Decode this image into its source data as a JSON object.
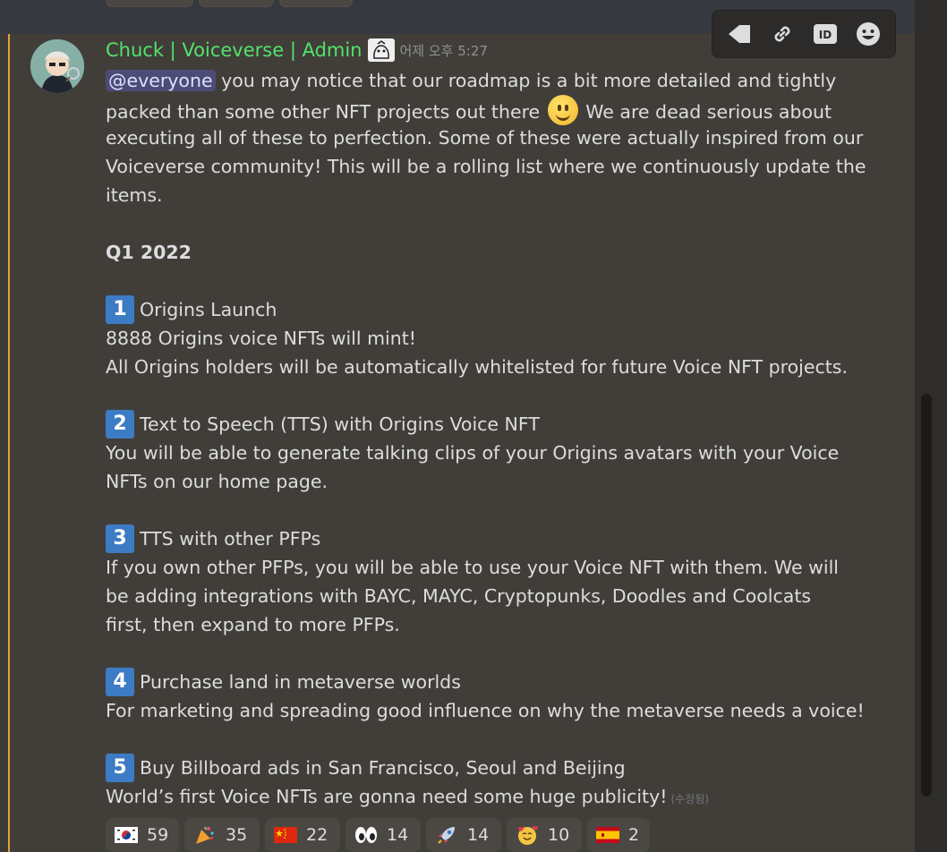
{
  "message": {
    "username": "Chuck | Voiceverse | Admin",
    "timestamp": "어제 오후 5:27",
    "mention": "@everyone",
    "intro_line1_rest": " you may notice that our roadmap is a bit more detailed and tightly",
    "intro_line2_a": "packed than some other NFT projects out there ",
    "intro_line2_b": " We are dead serious about",
    "intro_line3": "executing all of these to perfection. Some of these were actually inspired from our",
    "intro_line4": "Voiceverse community! This will be a rolling list where we continuously update the",
    "intro_line5": "items.",
    "section_title": "Q1 2022",
    "items": [
      {
        "number": "1",
        "title": "Origins Launch",
        "lines": [
          "8888 Origins voice NFTs will mint!",
          "All Origins holders will be automatically whitelisted for future Voice NFT projects."
        ]
      },
      {
        "number": "2",
        "title": "Text to Speech (TTS) with Origins Voice NFT",
        "lines": [
          "You will be able to generate talking clips of your Origins avatars with your Voice",
          "NFTs on our home page."
        ]
      },
      {
        "number": "3",
        "title": "TTS with other PFPs",
        "lines": [
          "If you own other PFPs, you will be able to use your Voice NFT with them. We will",
          "be adding integrations with BAYC, MAYC, Cryptopunks, Doodles and Coolcats",
          "first, then expand to more PFPs."
        ]
      },
      {
        "number": "4",
        "title": "Purchase land in metaverse worlds",
        "lines": [
          "For marketing and spreading good influence on why the metaverse needs a voice!"
        ]
      },
      {
        "number": "5",
        "title": "Buy Billboard ads in San Francisco, Seoul and Beijing",
        "lines": [
          "World’s first Voice NFTs are gonna need some huge publicity!"
        ]
      }
    ],
    "edited_label": "(수정됨)"
  },
  "reactions": [
    {
      "icon": "korea-flag-icon",
      "count": "59"
    },
    {
      "icon": "party-popper-icon",
      "count": "35"
    },
    {
      "icon": "china-flag-icon",
      "count": "22"
    },
    {
      "icon": "eyes-icon",
      "count": "14"
    },
    {
      "icon": "rocket-icon",
      "count": "14"
    },
    {
      "icon": "smiling-hearts-icon",
      "count": "10"
    },
    {
      "icon": "spain-flag-icon",
      "count": "2"
    }
  ],
  "toolbar": [
    "reply-icon",
    "link-icon",
    "id-icon",
    "add-reaction-icon"
  ],
  "colors": {
    "username": "#52e36a",
    "accent_bar": "#e2a03a",
    "mention_bg": "#4b4c78",
    "number_box": "#3d7bc4"
  }
}
